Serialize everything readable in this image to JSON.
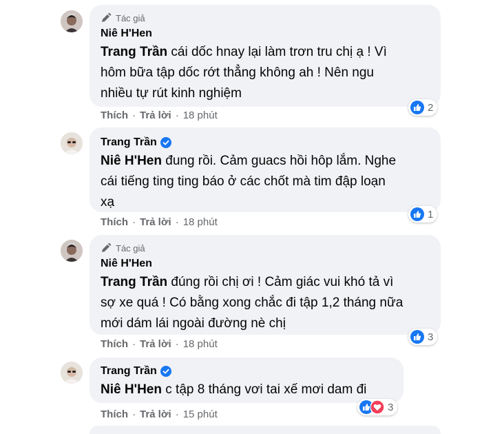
{
  "comments": [
    {
      "badge": "Tác giả",
      "author": "Niê H'Hen",
      "mention": "Trang Trần",
      "lines": [
        " cái dốc hnay lại làm trơn tru chị ạ ! Vì",
        "hôm bữa tập dốc rớt thẳng không ah ! Nên ngu",
        "nhiều tự rút kinh nghiệm"
      ],
      "like": "Thích",
      "reply": "Trả lời",
      "time": "18 phút",
      "reaction_count": "2"
    },
    {
      "author": "Trang Trần",
      "mention": "Niê H'Hen",
      "lines": [
        " đung rồi. Cảm guacs hồi hôp lắm. Nghe",
        "cái tiếng ting ting báo ở các chốt mà tim đập loạn",
        "xạ"
      ],
      "like": "Thích",
      "reply": "Trả lời",
      "time": "18 phút",
      "reaction_count": "1"
    },
    {
      "badge": "Tác giả",
      "author": "Niê H'Hen",
      "mention": "Trang Trần",
      "lines": [
        " đúng rồi chị ơi ! Cảm giác vui khó tả vì",
        "sợ xe quá ! Có bằng xong chắc đi tập 1,2 tháng nữa",
        "mới dám lái ngoài đường nè chị"
      ],
      "like": "Thích",
      "reply": "Trả lời",
      "time": "18 phút",
      "reaction_count": "3"
    },
    {
      "author": "Trang Trần",
      "mention": "Niê H'Hen",
      "lines": [
        " c tập 8 tháng vơi tai xế mơi dam đi"
      ],
      "like": "Thích",
      "reply": "Trả lời",
      "time": "15 phút",
      "reaction_count": "3"
    }
  ],
  "separator": "·",
  "colors": {
    "bubble": "#f0f2f5",
    "like_blue": "#1877f2",
    "love_red": "#f33e58",
    "meta_gray": "#65676b"
  }
}
